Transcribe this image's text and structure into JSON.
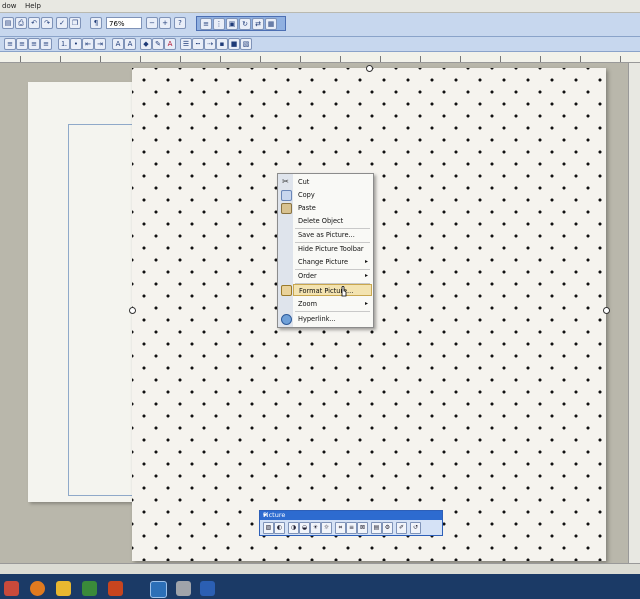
{
  "menubar": {
    "items": [
      "dow",
      "Help"
    ]
  },
  "toolbar": {
    "zoom": "76%"
  },
  "context_menu": {
    "items": [
      {
        "label": "Cut",
        "icon": "scissors-icon",
        "submenu": false
      },
      {
        "label": "Copy",
        "icon": "copy-icon",
        "submenu": false
      },
      {
        "label": "Paste",
        "icon": "paste-icon",
        "submenu": false
      },
      {
        "label": "Delete Object",
        "icon": "",
        "submenu": false
      },
      {
        "label": "Save as Picture...",
        "icon": "",
        "submenu": false
      },
      {
        "label": "Hide Picture Toolbar",
        "icon": "",
        "submenu": false
      },
      {
        "label": "Change Picture",
        "icon": "",
        "submenu": true
      },
      {
        "label": "Order",
        "icon": "",
        "submenu": true
      },
      {
        "label": "Format Picture...",
        "icon": "format-picture-icon",
        "submenu": false,
        "highlighted": true
      },
      {
        "label": "Zoom",
        "icon": "",
        "submenu": true
      },
      {
        "label": "Hyperlink...",
        "icon": "hyperlink-icon",
        "submenu": false
      }
    ],
    "submenu_arrow": "▸"
  },
  "picture_toolbar": {
    "title": "Picture",
    "dropdown": "▾",
    "close": "×"
  },
  "colors": {
    "accent": "#2d6bd0",
    "highlight": "#f3e3b0",
    "canvas": "#b9b7ab"
  }
}
